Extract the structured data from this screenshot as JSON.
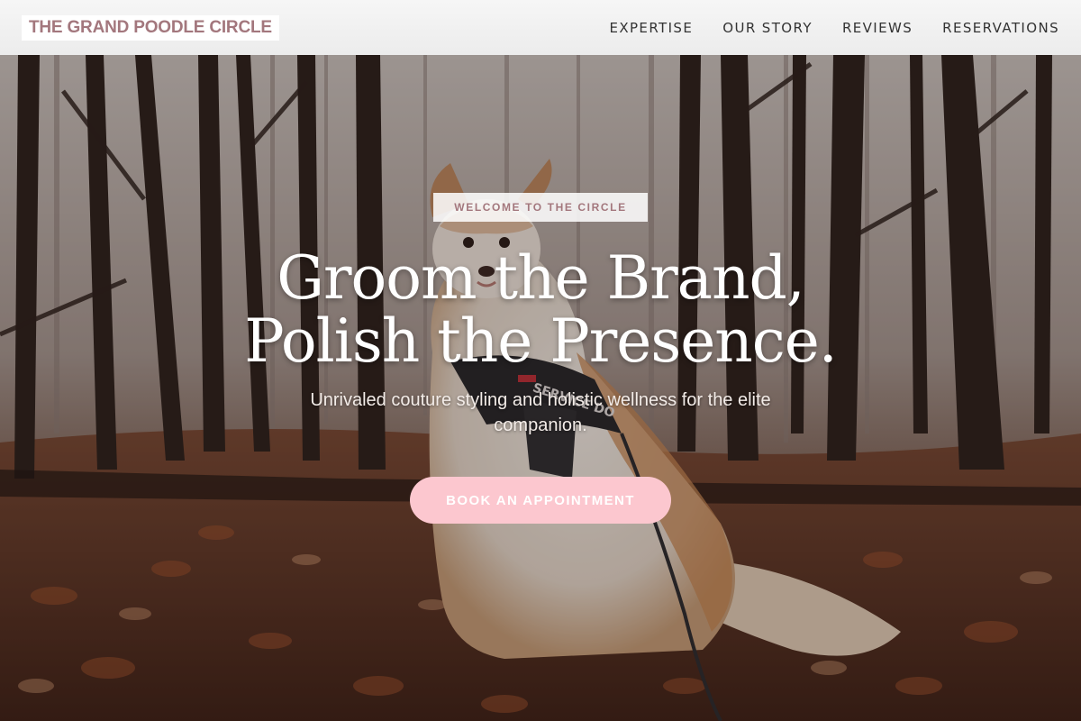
{
  "header": {
    "logo": "THE GRAND POODLE CIRCLE",
    "nav": [
      "EXPERTISE",
      "OUR STORY",
      "REVIEWS",
      "RESERVATIONS"
    ]
  },
  "hero": {
    "badge": "WELCOME TO THE CIRCLE",
    "headline_line1": "Groom the Brand,",
    "headline_line2": "Polish the Presence.",
    "tagline": "Unrivaled couture styling and holistic wellness for the elite companion.",
    "cta": "BOOK AN APPOINTMENT",
    "harness_text": "SERVICE DO"
  },
  "colors": {
    "brand": "#a3777d",
    "cta": "#fcc7cf",
    "header_bg": "#f2f2f2"
  },
  "icons": [
    "background-forest-dog-image"
  ]
}
